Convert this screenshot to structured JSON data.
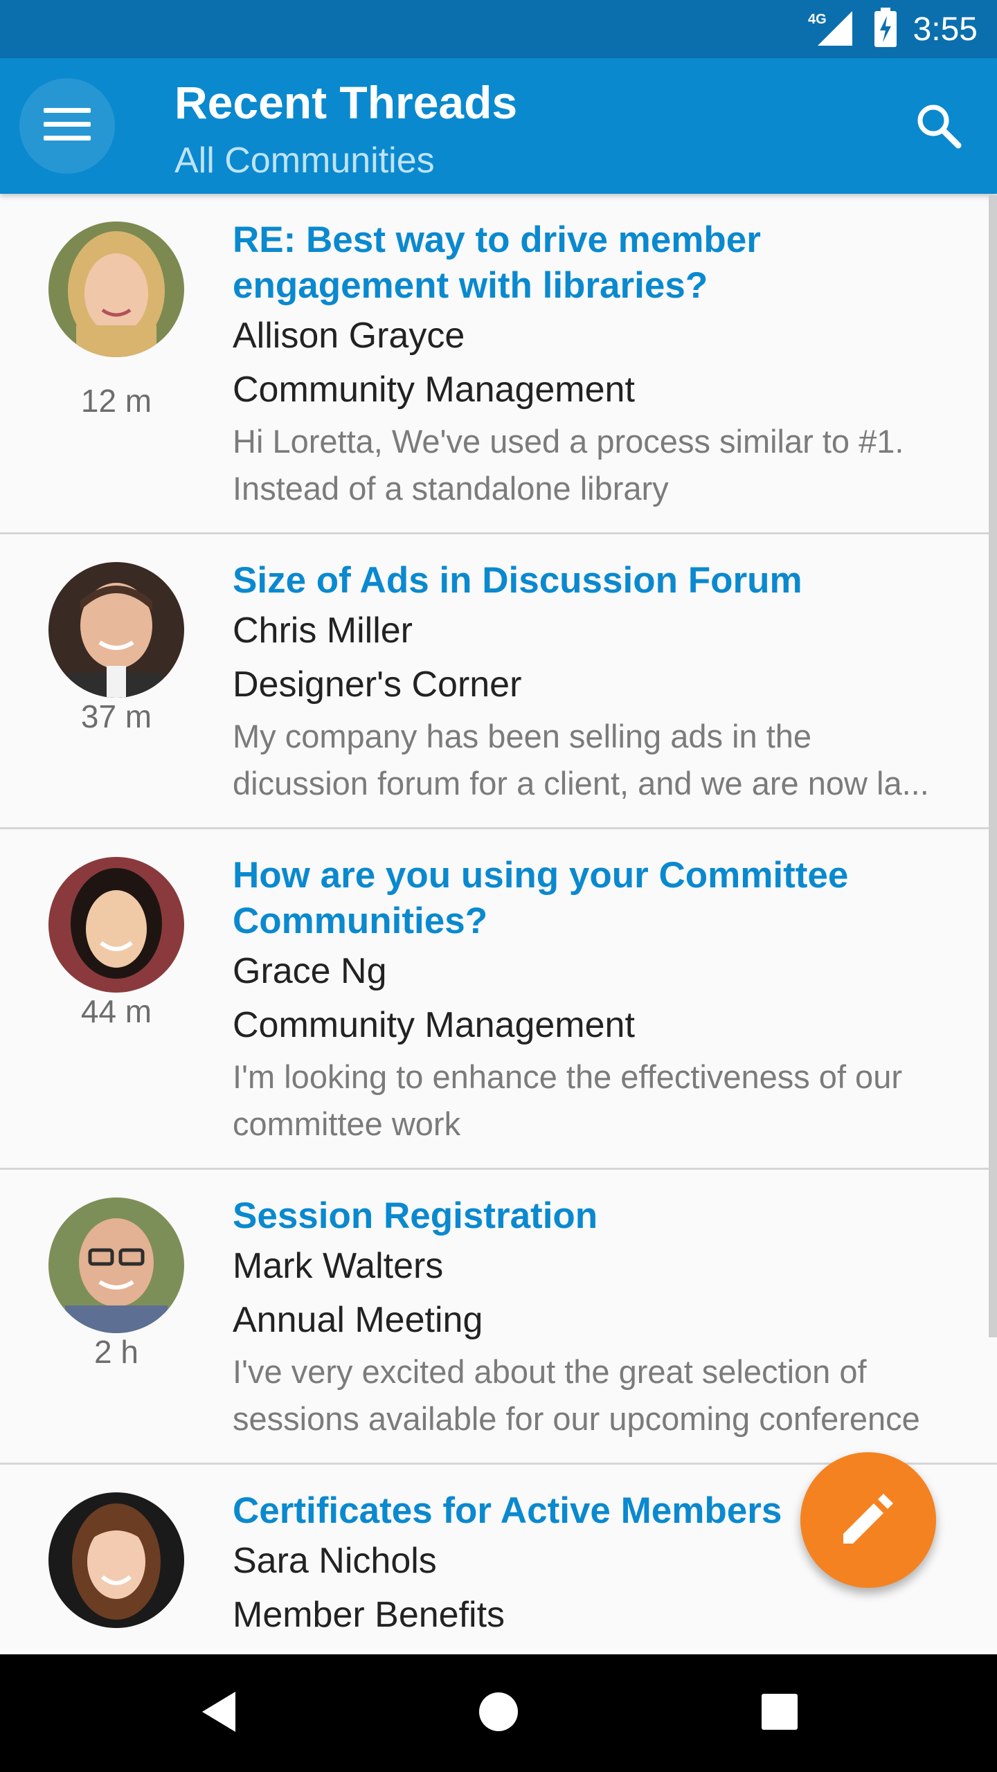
{
  "status_bar": {
    "time": "3:55",
    "network_label": "4G",
    "icons": [
      "signal-icon",
      "battery-charging-icon"
    ]
  },
  "app_bar": {
    "title": "Recent Threads",
    "subtitle": "All Communities",
    "icons": [
      "menu-icon",
      "search-icon"
    ]
  },
  "threads": [
    {
      "title": "RE: Best way to drive member engagement with libraries?",
      "author": "Allison Grayce",
      "community": "Community Management",
      "snippet": "Hi Loretta, We've used a process similar to #1. Instead of a standalone library",
      "time": "12 m"
    },
    {
      "title": "Size of Ads in Discussion Forum",
      "author": "Chris Miller",
      "community": "Designer's Corner",
      "snippet": "My company has been selling ads in the dicussion forum for a client, and we are now la...",
      "time": "37 m"
    },
    {
      "title": "How are you using your Committee Communities?",
      "author": "Grace Ng",
      "community": "Community Management",
      "snippet": "I'm looking to enhance the effectiveness of our committee work",
      "time": "44 m"
    },
    {
      "title": "Session Registration",
      "author": "Mark Walters",
      "community": "Annual Meeting",
      "snippet": "I've very excited about the great selection of sessions available for our upcoming conference",
      "time": "2 h"
    },
    {
      "title": "Certificates for Active Members",
      "author": "Sara Nichols",
      "community": "Member Benefits",
      "snippet": "",
      "time": ""
    }
  ],
  "fab": {
    "icon": "pencil-icon"
  },
  "nav_bar": {
    "icons": [
      "back-icon",
      "home-icon",
      "recents-icon"
    ]
  },
  "colors": {
    "status_bar": "#0b6fae",
    "app_bar": "#0a89cf",
    "title_accent": "#0a89cf",
    "fab": "#f58220"
  }
}
